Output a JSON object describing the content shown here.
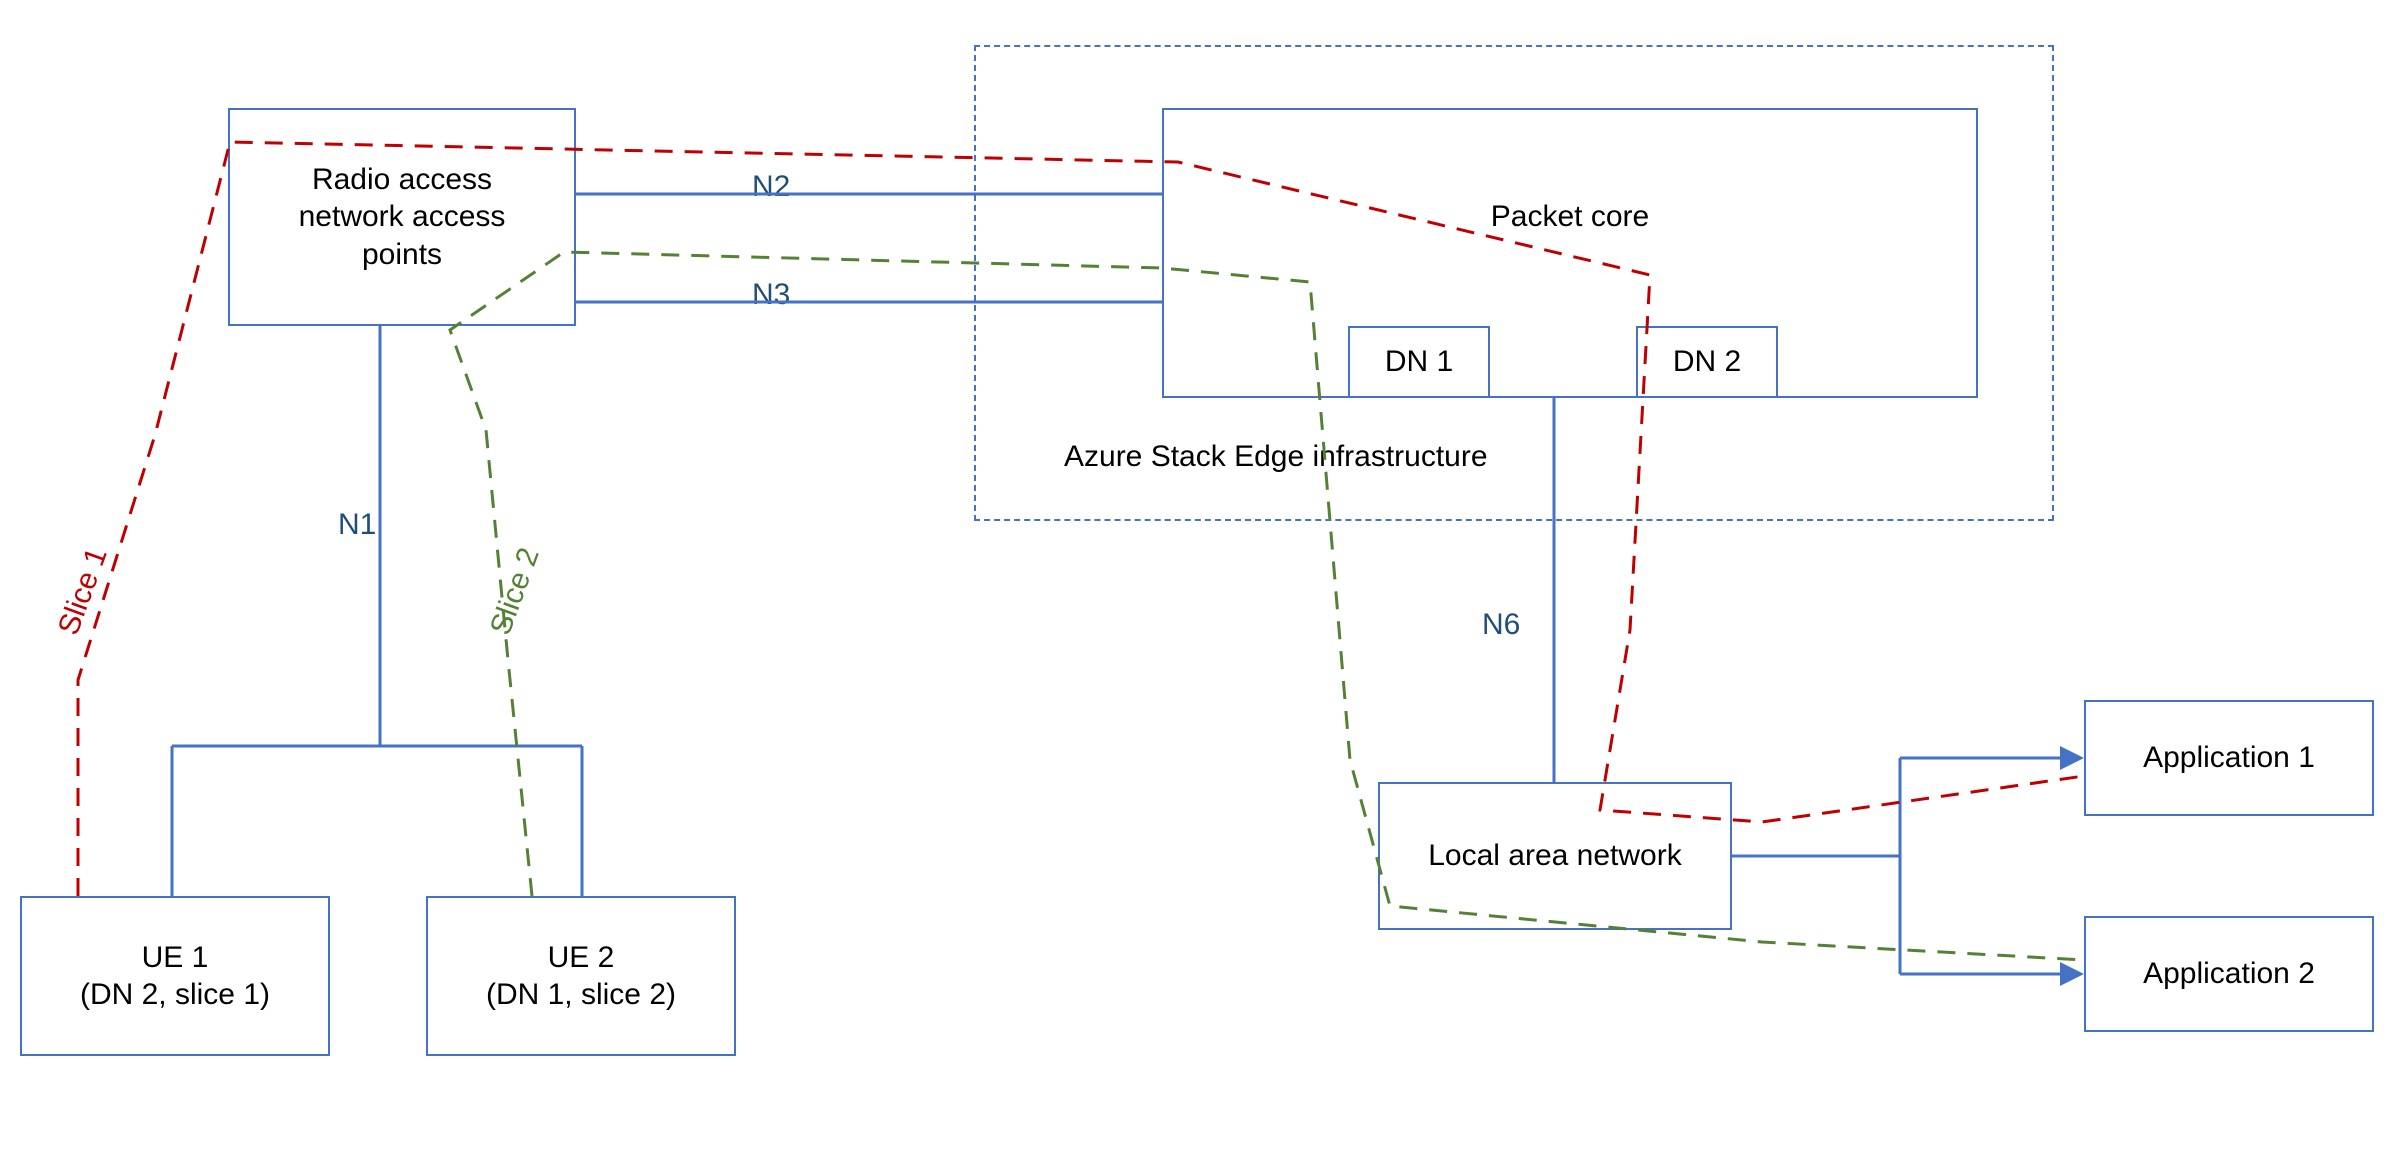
{
  "nodes": {
    "ran": {
      "line1": "Radio access",
      "line2": "network access",
      "line3": "points"
    },
    "packet_core": {
      "label": "Packet core"
    },
    "dn1": {
      "label": "DN 1"
    },
    "dn2": {
      "label": "DN 2"
    },
    "ase_region": {
      "label": "Azure Stack Edge infrastructure"
    },
    "ue1": {
      "line1": "UE 1",
      "line2": "(DN 2, slice 1)"
    },
    "ue2": {
      "line1": "UE 2",
      "line2": "(DN 1, slice 2)"
    },
    "lan": {
      "label": "Local area network"
    },
    "app1": {
      "label": "Application 1"
    },
    "app2": {
      "label": "Application 2"
    }
  },
  "links": {
    "n1": "N1",
    "n2": "N2",
    "n3": "N3",
    "n6": "N6"
  },
  "slices": {
    "slice1": "Slice 1",
    "slice2": "Slice 2"
  },
  "colors": {
    "box_border": "#4472c4",
    "slice1": "#c00000",
    "slice2": "#548235",
    "link_text": "#1f4e79"
  }
}
